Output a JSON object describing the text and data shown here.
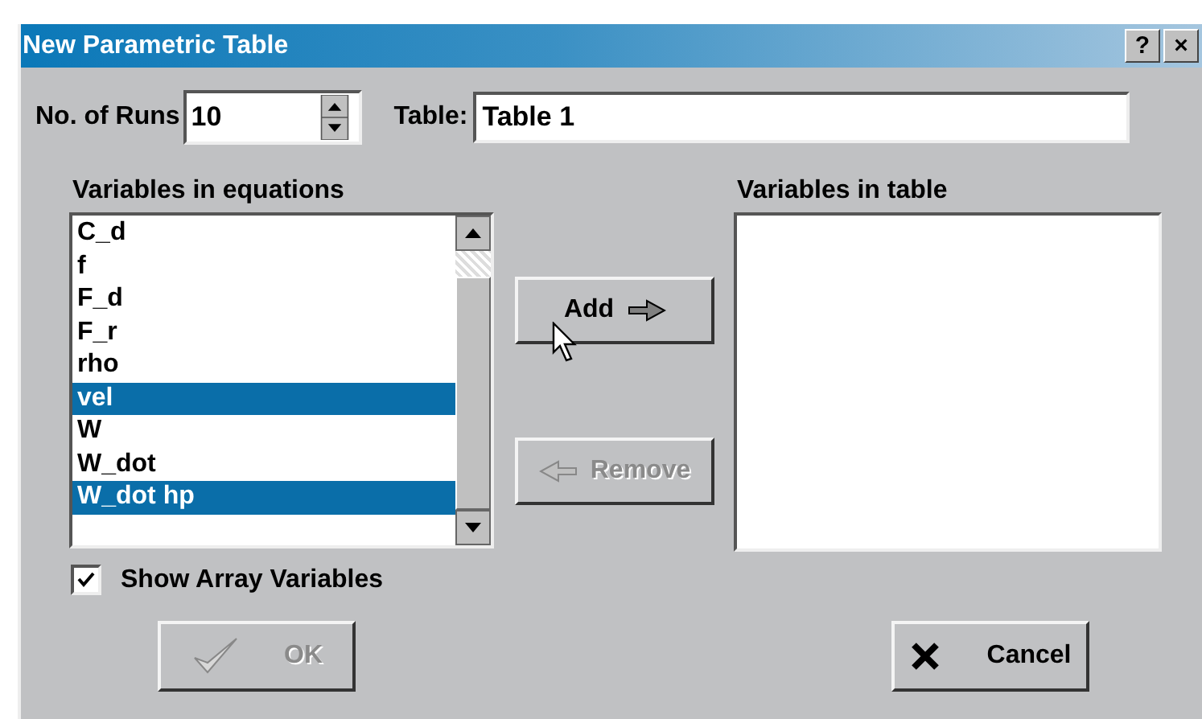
{
  "window": {
    "title": "New Parametric Table",
    "title_buttons": [
      "?",
      "×"
    ]
  },
  "runs": {
    "label": "No. of Runs",
    "value": "10"
  },
  "table": {
    "label": "Table:",
    "value": "Table 1"
  },
  "equations_list": {
    "label": "Variables in equations",
    "items": [
      {
        "text": "C_d",
        "selected": false
      },
      {
        "text": "f",
        "selected": false
      },
      {
        "text": "F_d",
        "selected": false
      },
      {
        "text": "F_r",
        "selected": false
      },
      {
        "text": "rho",
        "selected": false
      },
      {
        "text": "vel",
        "selected": true
      },
      {
        "text": "W",
        "selected": false
      },
      {
        "text": "W_dot",
        "selected": false
      },
      {
        "text": "W_dot hp",
        "selected": true
      }
    ]
  },
  "table_list": {
    "label": "Variables in table"
  },
  "add_button": {
    "label": "Add",
    "disabled": false
  },
  "remove_button": {
    "label": "Remove",
    "disabled": true
  },
  "show_array": {
    "label": "Show Array Variables",
    "checked": true
  },
  "ok_button": {
    "label": "OK",
    "disabled": true
  },
  "cancel_button": {
    "label": "Cancel",
    "disabled": false
  }
}
